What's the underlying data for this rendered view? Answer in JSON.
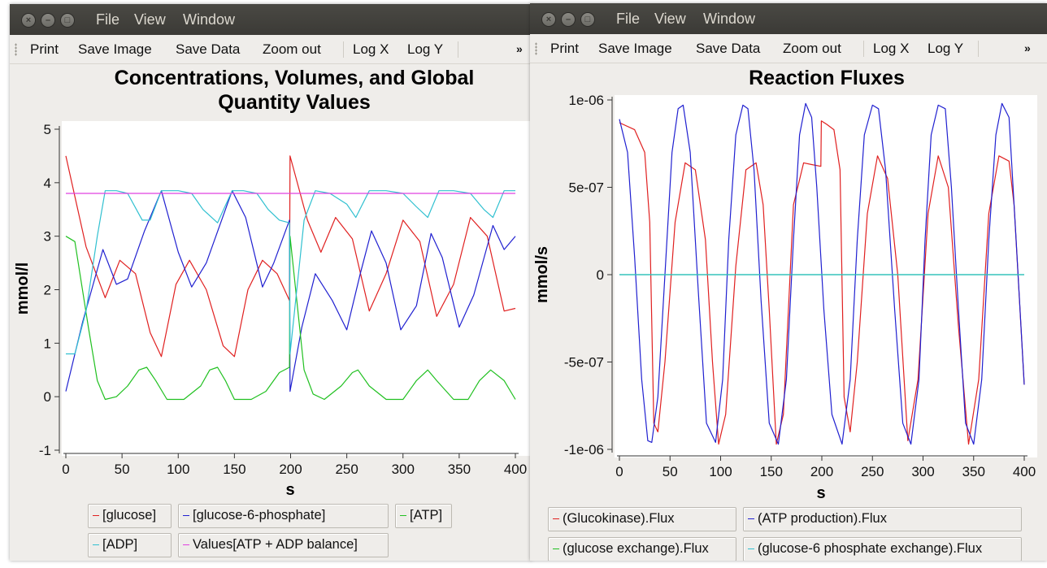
{
  "windows": [
    {
      "menu": [
        "File",
        "View",
        "Window"
      ],
      "toolbar": {
        "print": "Print",
        "save_image": "Save Image",
        "save_data": "Save Data",
        "zoom_out": "Zoom out",
        "log_x": "Log X",
        "log_y": "Log Y",
        "more": "»"
      },
      "title_line1": "Concentrations, Volumes, and Global",
      "title_line2": "Quantity Values",
      "legend": [
        {
          "label": "[glucose]",
          "color": "#e02020"
        },
        {
          "label": "[glucose-6-phosphate]",
          "color": "#2020d0"
        },
        {
          "label": "[ATP]",
          "color": "#20c020"
        },
        {
          "label": "[ADP]",
          "color": "#30c0d0"
        },
        {
          "label": "Values[ATP + ADP balance]",
          "color": "#e040e0"
        }
      ]
    },
    {
      "menu": [
        "File",
        "View",
        "Window"
      ],
      "toolbar": {
        "print": "Print",
        "save_image": "Save Image",
        "save_data": "Save Data",
        "zoom_out": "Zoom out",
        "log_x": "Log X",
        "log_y": "Log Y",
        "more": "»"
      },
      "title": "Reaction Fluxes",
      "legend": [
        {
          "label": "(Glucokinase).Flux",
          "color": "#e02020"
        },
        {
          "label": "(ATP production).Flux",
          "color": "#2020d0"
        },
        {
          "label": "(glucose exchange).Flux",
          "color": "#20c020"
        },
        {
          "label": "(glucose-6 phosphate exchange).Flux",
          "color": "#30c0d0"
        }
      ]
    }
  ],
  "chart_data": [
    {
      "type": "line",
      "title": "Concentrations, Volumes, and Global Quantity Values",
      "xlabel": "s",
      "ylabel": "mmol/l",
      "xlim": [
        0,
        400
      ],
      "ylim": [
        -1,
        5
      ],
      "xticks": [
        "0",
        "50",
        "100",
        "150",
        "200",
        "250",
        "300",
        "350",
        "400"
      ],
      "yticks": [
        "-1",
        "0",
        "1",
        "2",
        "3",
        "4",
        "5"
      ],
      "series": [
        {
          "name": "[glucose]",
          "color": "#e02020",
          "x": [
            0,
            18,
            35,
            48,
            62,
            75,
            85,
            98,
            110,
            125,
            140,
            150,
            162,
            175,
            188,
            199,
            199.5,
            215,
            227,
            240,
            255,
            270,
            285,
            300,
            315,
            330,
            345,
            360,
            375,
            390,
            400
          ],
          "y": [
            4.5,
            2.8,
            1.85,
            2.55,
            2.3,
            1.2,
            0.75,
            2.1,
            2.55,
            2.0,
            0.95,
            0.75,
            2.0,
            2.55,
            2.3,
            1.8,
            4.5,
            3.3,
            2.7,
            3.35,
            2.95,
            1.6,
            2.3,
            3.3,
            2.9,
            1.5,
            2.1,
            3.35,
            3.0,
            1.6,
            1.65
          ]
        },
        {
          "name": "[glucose-6-phosphate]",
          "color": "#2020d0",
          "x": [
            0,
            15,
            33,
            45,
            55,
            70,
            85,
            100,
            112,
            125,
            148,
            160,
            175,
            185,
            199,
            199.5,
            210,
            222,
            237,
            250,
            262,
            272,
            285,
            298,
            312,
            325,
            335,
            350,
            363,
            380,
            390,
            400
          ],
          "y": [
            0.1,
            1.4,
            2.75,
            2.1,
            2.2,
            3.1,
            3.85,
            2.7,
            2.05,
            2.5,
            3.85,
            3.35,
            2.05,
            2.5,
            3.3,
            0.1,
            1.3,
            2.3,
            1.8,
            1.25,
            2.3,
            3.1,
            2.5,
            1.25,
            1.7,
            3.05,
            2.6,
            1.3,
            1.9,
            3.2,
            2.75,
            3.0
          ]
        },
        {
          "name": "[ATP]",
          "color": "#20c020",
          "x": [
            0,
            8,
            20,
            28,
            35,
            45,
            55,
            65,
            72,
            80,
            90,
            105,
            120,
            128,
            135,
            142,
            150,
            165,
            178,
            190,
            199,
            199.5,
            212,
            220,
            230,
            245,
            255,
            260,
            270,
            285,
            300,
            312,
            322,
            330,
            345,
            358,
            368,
            378,
            390,
            400
          ],
          "y": [
            3.0,
            2.9,
            1.3,
            0.3,
            -0.05,
            0.0,
            0.2,
            0.5,
            0.55,
            0.3,
            -0.05,
            -0.05,
            0.2,
            0.5,
            0.55,
            0.3,
            -0.05,
            -0.05,
            0.1,
            0.45,
            0.55,
            3.0,
            0.5,
            0.05,
            -0.05,
            0.2,
            0.45,
            0.5,
            0.2,
            -0.05,
            -0.05,
            0.3,
            0.5,
            0.3,
            -0.05,
            -0.05,
            0.3,
            0.5,
            0.3,
            -0.05
          ]
        },
        {
          "name": "[ADP]",
          "color": "#30c0d0",
          "x": [
            0,
            8,
            18,
            28,
            35,
            45,
            55,
            68,
            75,
            85,
            100,
            112,
            122,
            135,
            148,
            158,
            170,
            180,
            190,
            199,
            199.5,
            212,
            222,
            235,
            250,
            258,
            270,
            285,
            300,
            312,
            322,
            332,
            345,
            360,
            372,
            380,
            390,
            400
          ],
          "y": [
            0.8,
            0.8,
            1.6,
            3.0,
            3.85,
            3.85,
            3.8,
            3.3,
            3.3,
            3.85,
            3.85,
            3.8,
            3.5,
            3.25,
            3.85,
            3.85,
            3.8,
            3.5,
            3.3,
            3.25,
            0.8,
            3.3,
            3.85,
            3.8,
            3.6,
            3.35,
            3.85,
            3.85,
            3.8,
            3.55,
            3.35,
            3.85,
            3.85,
            3.8,
            3.5,
            3.35,
            3.85,
            3.85
          ]
        },
        {
          "name": "Values[ATP + ADP balance]",
          "color": "#e040e0",
          "x": [
            0,
            400
          ],
          "y": [
            3.8,
            3.8
          ]
        }
      ]
    },
    {
      "type": "line",
      "title": "Reaction Fluxes",
      "xlabel": "s",
      "ylabel": "mmol/s",
      "xlim": [
        0,
        400
      ],
      "ylim": [
        -1e-06,
        1e-06
      ],
      "xticks": [
        "0",
        "50",
        "100",
        "150",
        "200",
        "250",
        "300",
        "350",
        "400"
      ],
      "yticks": [
        "-1e-06",
        "-5e-07",
        "0",
        "5e-07",
        "1e-06"
      ],
      "series": [
        {
          "name": "(Glucokinase).Flux",
          "color": "#e02020",
          "x": [
            0,
            15,
            25,
            30,
            34,
            38,
            45,
            55,
            65,
            75,
            85,
            92,
            98,
            105,
            115,
            125,
            135,
            142,
            148,
            155,
            162,
            172,
            182,
            190,
            199,
            199.5,
            205,
            212,
            218,
            222,
            228,
            235,
            245,
            255,
            265,
            275,
            285,
            295,
            305,
            315,
            325,
            335,
            345,
            355,
            365,
            375,
            385,
            390,
            400
          ],
          "y": [
            8.7e-07,
            8.3e-07,
            7e-07,
            3e-07,
            -8.5e-07,
            -9e-07,
            -5e-07,
            3e-07,
            6.4e-07,
            6e-07,
            2e-07,
            -5e-07,
            -9.7e-07,
            -8e-07,
            5e-08,
            6e-07,
            6.4e-07,
            4e-07,
            -2e-07,
            -9.7e-07,
            -8e-07,
            4e-07,
            6.4e-07,
            6.3e-07,
            6.2e-07,
            8.8e-07,
            8.6e-07,
            8.3e-07,
            6e-07,
            -7e-07,
            -9e-07,
            -5e-07,
            3.5e-07,
            6.8e-07,
            5.5e-07,
            0,
            -9.5e-07,
            -6e-07,
            3.5e-07,
            6.8e-07,
            5e-07,
            -3e-07,
            -9.7e-07,
            -6e-07,
            3.5e-07,
            6.8e-07,
            6.5e-07,
            4e-07,
            -6.3e-07
          ]
        },
        {
          "name": "(ATP production).Flux",
          "color": "#2020d0",
          "x": [
            0,
            8,
            15,
            22,
            28,
            32,
            38,
            45,
            52,
            58,
            63,
            70,
            78,
            86,
            95,
            102,
            108,
            115,
            122,
            127,
            133,
            140,
            148,
            157,
            165,
            172,
            178,
            184,
            190,
            195,
            202,
            210,
            220,
            228,
            235,
            242,
            250,
            256,
            263,
            272,
            280,
            288,
            296,
            302,
            308,
            315,
            322,
            328,
            335,
            342,
            350,
            358,
            365,
            372,
            378,
            385,
            392,
            400
          ],
          "y": [
            8.9e-07,
            7e-07,
            1e-07,
            -6e-07,
            -9.5e-07,
            -9.6e-07,
            -7e-07,
            0,
            7e-07,
            9.5e-07,
            9.7e-07,
            7e-07,
            -1e-07,
            -8.5e-07,
            -9.6e-07,
            -6e-07,
            2e-07,
            8e-07,
            9.7e-07,
            9.5e-07,
            6e-07,
            -1.5e-07,
            -8.5e-07,
            -9.7e-07,
            -6e-07,
            2e-07,
            8e-07,
            9.8e-07,
            9e-07,
            5e-07,
            -2e-07,
            -8e-07,
            -9.7e-07,
            -6e-07,
            2e-07,
            8e-07,
            9.7e-07,
            9.5e-07,
            6e-07,
            -2e-07,
            -8.5e-07,
            -9.7e-07,
            -6e-07,
            2e-07,
            8e-07,
            9.7e-07,
            9.5e-07,
            5e-07,
            -2e-07,
            -8.5e-07,
            -9.7e-07,
            -6e-07,
            2e-07,
            8e-07,
            9.8e-07,
            9e-07,
            2e-07,
            -6.3e-07
          ]
        },
        {
          "name": "(glucose exchange).Flux",
          "color": "#20c020",
          "x": [
            0,
            400
          ],
          "y": [
            0,
            0
          ]
        },
        {
          "name": "(glucose-6 phosphate exchange).Flux",
          "color": "#30c0d0",
          "x": [
            0,
            400
          ],
          "y": [
            0,
            0
          ]
        }
      ]
    }
  ]
}
